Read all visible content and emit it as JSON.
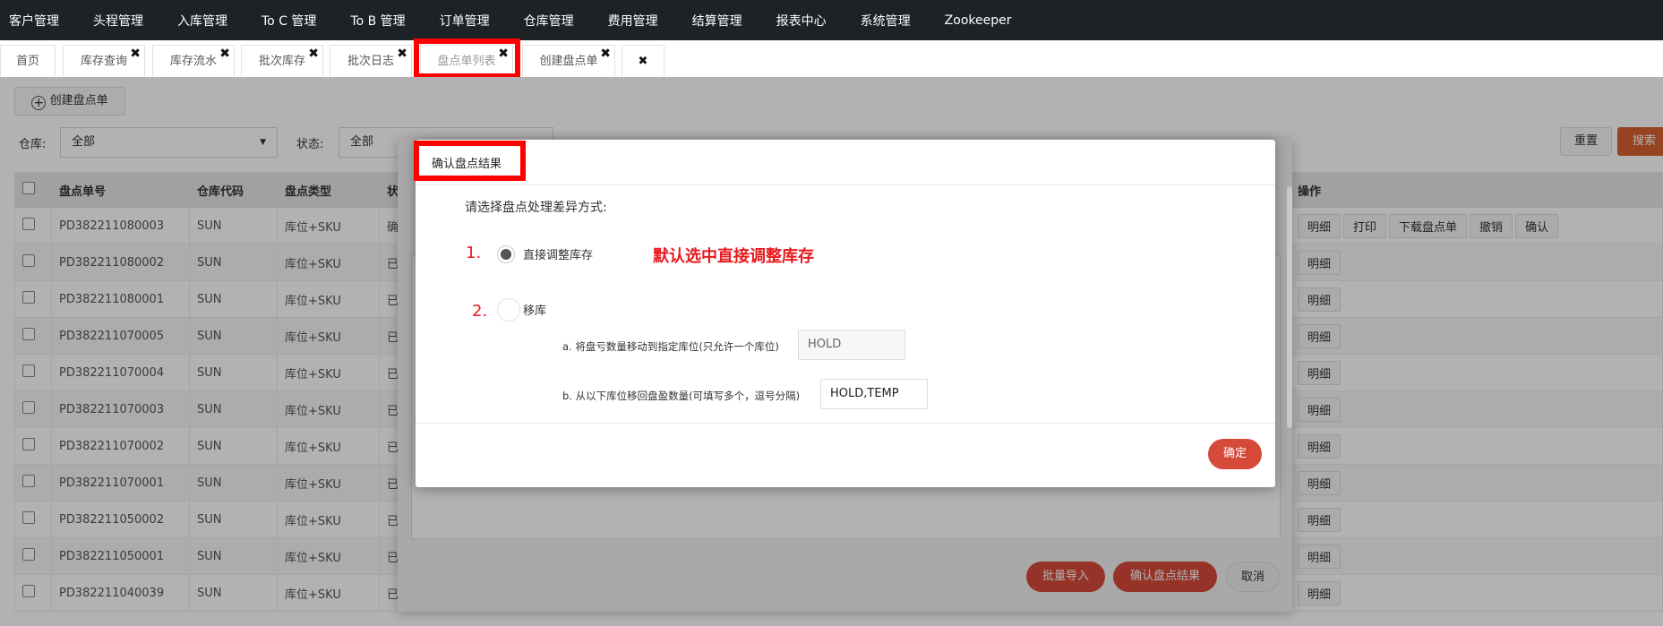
{
  "nav": [
    "客户管理",
    "头程管理",
    "入库管理",
    "To C 管理",
    "To B 管理",
    "订单管理",
    "仓库管理",
    "费用管理",
    "结算管理",
    "报表中心",
    "系统管理",
    "Zookeeper"
  ],
  "tabs": [
    {
      "label": "首页",
      "closable": false
    },
    {
      "label": "库存查询",
      "closable": true
    },
    {
      "label": "库存流水",
      "closable": true
    },
    {
      "label": "批次库存",
      "closable": true
    },
    {
      "label": "批次日志",
      "closable": true
    },
    {
      "label": "盘点单列表",
      "closable": true,
      "active": true
    },
    {
      "label": "创建盘点单",
      "closable": true
    },
    {
      "label": "",
      "closable": true
    }
  ],
  "toolbar": {
    "create_label": "创建盘点单"
  },
  "filters": {
    "warehouse_label": "仓库:",
    "warehouse_value": "全部",
    "status_label": "状态:",
    "status_value": "全部",
    "reset_label": "重置",
    "search_label": "搜索"
  },
  "table": {
    "columns": [
      "盘点单号",
      "仓库代码",
      "盘点类型",
      "状态"
    ],
    "ops_header": "操作",
    "rows": [
      {
        "no": "PD382211080003",
        "wh": "SUN",
        "type": "库位+SKU",
        "status": "确认中",
        "ops": [
          "明细",
          "打印",
          "下载盘点单",
          "撤销",
          "确认"
        ]
      },
      {
        "no": "PD382211080002",
        "wh": "SUN",
        "type": "库位+SKU",
        "status": "已完成",
        "ops": [
          "明细"
        ]
      },
      {
        "no": "PD382211080001",
        "wh": "SUN",
        "type": "库位+SKU",
        "status": "已完成",
        "ops": [
          "明细"
        ]
      },
      {
        "no": "PD382211070005",
        "wh": "SUN",
        "type": "库位+SKU",
        "status": "已完成",
        "ops": [
          "明细"
        ]
      },
      {
        "no": "PD382211070004",
        "wh": "SUN",
        "type": "库位+SKU",
        "status": "已完成",
        "ops": [
          "明细"
        ]
      },
      {
        "no": "PD382211070003",
        "wh": "SUN",
        "type": "库位+SKU",
        "status": "已完成",
        "ops": [
          "明细"
        ]
      },
      {
        "no": "PD382211070002",
        "wh": "SUN",
        "type": "库位+SKU",
        "status": "已完成",
        "ops": [
          "明细"
        ]
      },
      {
        "no": "PD382211070001",
        "wh": "SUN",
        "type": "库位+SKU",
        "status": "已完成",
        "ops": [
          "明细"
        ]
      },
      {
        "no": "PD382211050002",
        "wh": "SUN",
        "type": "库位+SKU",
        "status": "已完成",
        "ops": [
          "明细"
        ]
      },
      {
        "no": "PD382211050001",
        "wh": "SUN",
        "type": "库位+SKU",
        "status": "已完成",
        "ops": [
          "明细"
        ]
      },
      {
        "no": "PD382211040039",
        "wh": "SUN",
        "type": "库位+SKU",
        "status": "已完成",
        "ops": [
          "明细"
        ]
      }
    ]
  },
  "outer_dialog": {
    "import_label": "批量导入",
    "confirm_label": "确认盘点结果",
    "cancel_label": "取消"
  },
  "dialog": {
    "title": "确认盘点结果",
    "prompt": "请选择盘点处理差异方式:",
    "num1": "1.",
    "num2": "2.",
    "option1": "直接调整库存",
    "option2": "移库",
    "note": "默认选中直接调整库存",
    "sub_a_label": "a. 将盘亏数量移动到指定库位(只允许一个库位)",
    "sub_a_value": "HOLD",
    "sub_b_label": "b. 从以下库位移回盘盈数量(可填写多个，逗号分隔)",
    "sub_b_value": "HOLD,TEMP",
    "ok_label": "确定"
  },
  "colors": {
    "topnav": "#1d2227",
    "highlight": "#ff0000",
    "primary": "#d64a3a",
    "annotation": "#e8191e"
  }
}
